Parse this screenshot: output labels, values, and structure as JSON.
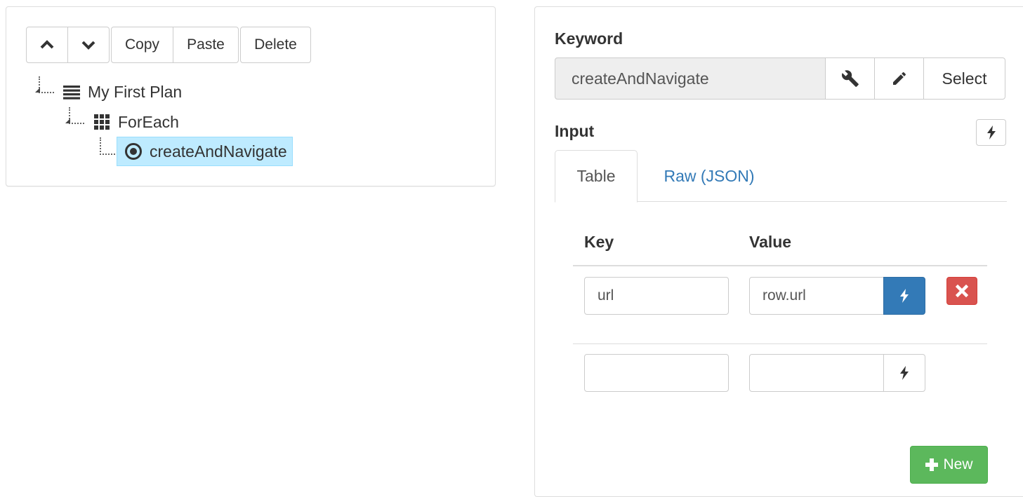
{
  "toolbar": {
    "move_up_icon": "chevron-up-icon",
    "move_down_icon": "chevron-down-icon",
    "copy_label": "Copy",
    "paste_label": "Paste",
    "delete_label": "Delete"
  },
  "tree": {
    "nodes": [
      {
        "label": "My First Plan",
        "icon": "list-icon",
        "level": 0
      },
      {
        "label": "ForEach",
        "icon": "grid-icon",
        "level": 1
      },
      {
        "label": "createAndNavigate",
        "icon": "record-icon",
        "level": 2,
        "selected": true
      }
    ]
  },
  "details": {
    "keyword_label": "Keyword",
    "keyword_value": "createAndNavigate",
    "keyword_buttons": {
      "wrench_icon": "wrench-icon",
      "pencil_icon": "pencil-icon",
      "select_label": "Select"
    },
    "input_label": "Input",
    "tabs": [
      {
        "label": "Table",
        "active": true
      },
      {
        "label": "Raw (JSON)",
        "active": false
      }
    ],
    "table": {
      "columns": [
        "Key",
        "Value"
      ],
      "rows": [
        {
          "key": "url",
          "value": "row.url",
          "dynamic": true
        },
        {
          "key": "",
          "value": "",
          "dynamic": false
        }
      ]
    },
    "new_button_label": "New"
  },
  "colors": {
    "primary": "#337ab7",
    "danger": "#d9534f",
    "success": "#5cb85c",
    "selected_node": "#beebff"
  }
}
